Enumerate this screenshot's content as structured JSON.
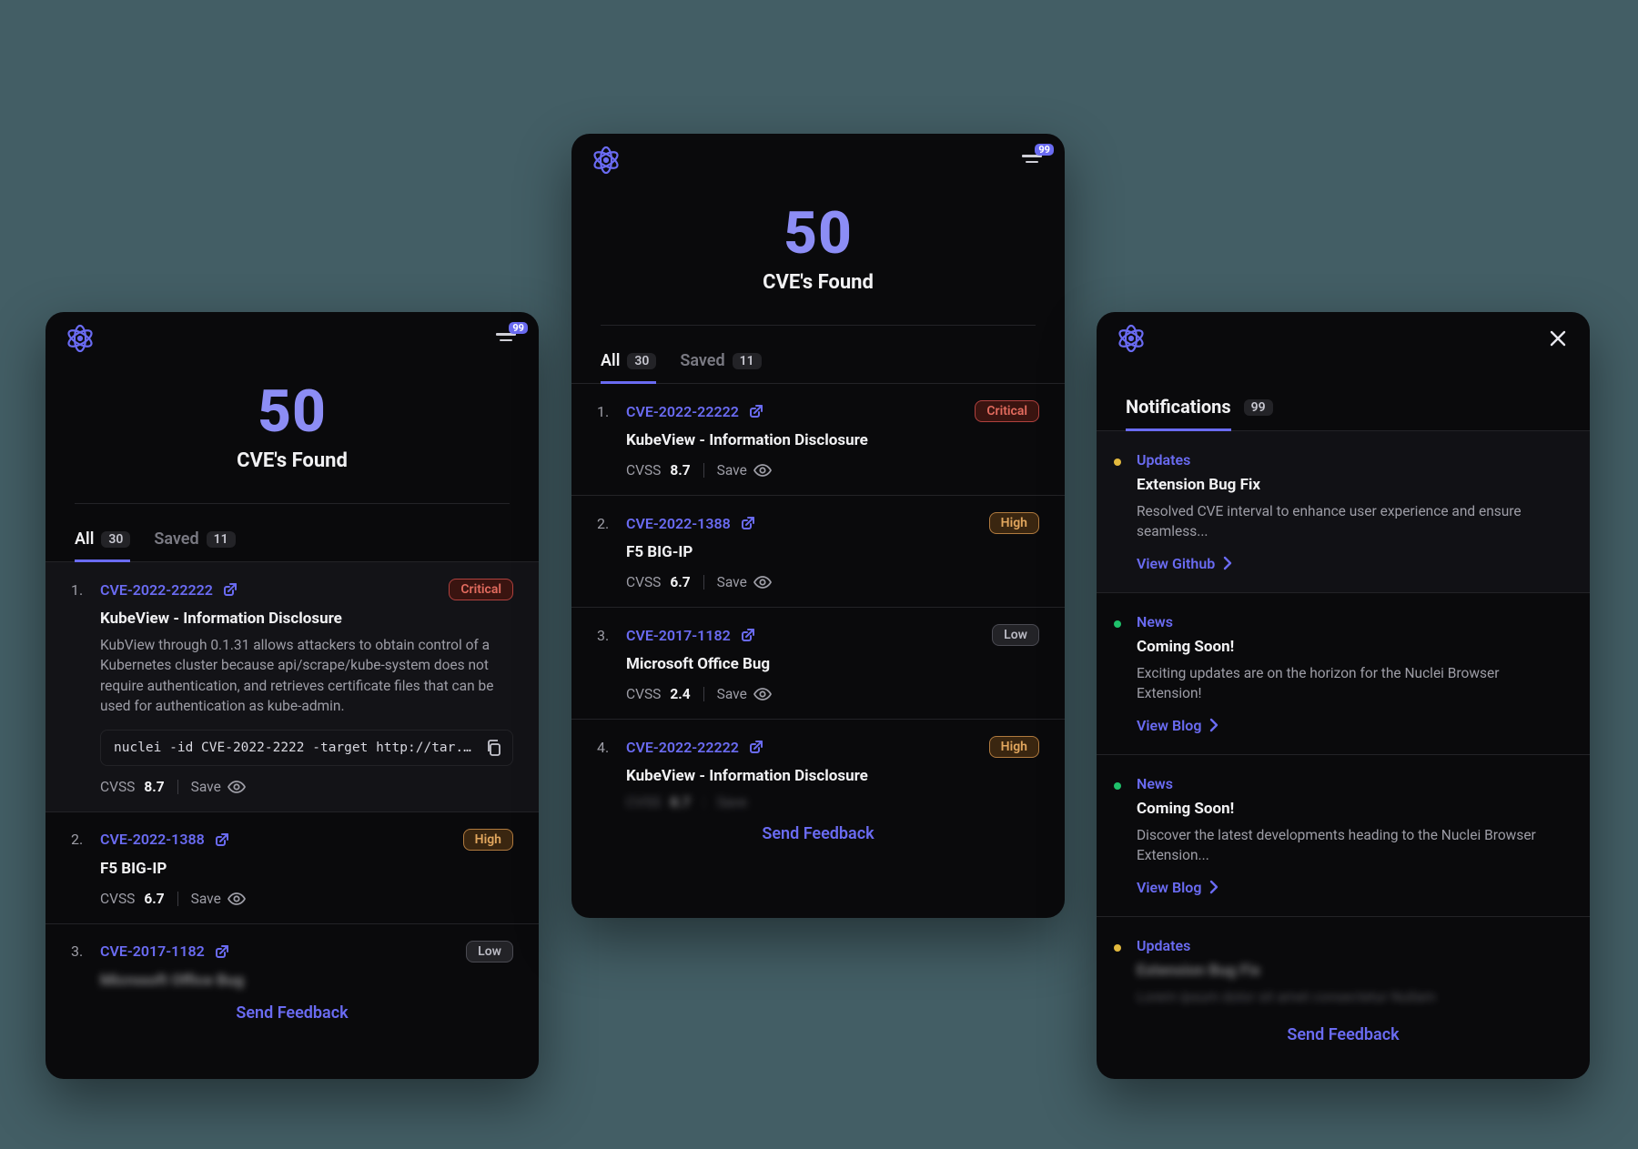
{
  "filter_badge": "99",
  "hero": {
    "count": "50",
    "label": "CVE's Found"
  },
  "tabs": {
    "all": {
      "label": "All",
      "count": "30"
    },
    "saved": {
      "label": "Saved",
      "count": "11"
    }
  },
  "severity": {
    "critical": "Critical",
    "high": "High",
    "low": "Low"
  },
  "labels": {
    "cvss": "CVSS",
    "save": "Save",
    "feedback": "Send Feedback"
  },
  "panel_a": {
    "items": [
      {
        "idx": "1.",
        "cve": "CVE-2022-22222",
        "sev": "critical",
        "title": "KubeView - Information Disclosure",
        "desc": "KubView through 0.1.31 allows attackers to obtain control of a Kubernetes cluster because api/scrape/kube-system does not require authentication, and retrieves certificate files that can be used for authentication as kube-admin.",
        "cmd": "nuclei -id CVE-2022-2222 -target http://tar...",
        "cvss": "8.7"
      },
      {
        "idx": "2.",
        "cve": "CVE-2022-1388",
        "sev": "high",
        "title": "F5 BIG-IP",
        "cvss": "6.7"
      },
      {
        "idx": "3.",
        "cve": "CVE-2017-1182",
        "sev": "low",
        "title_blur": "Microsoft Office Bug"
      }
    ]
  },
  "panel_b": {
    "items": [
      {
        "idx": "1.",
        "cve": "CVE-2022-22222",
        "sev": "critical",
        "title": "KubeView - Information Disclosure",
        "cvss": "8.7"
      },
      {
        "idx": "2.",
        "cve": "CVE-2022-1388",
        "sev": "high",
        "title": "F5 BIG-IP",
        "cvss": "6.7"
      },
      {
        "idx": "3.",
        "cve": "CVE-2017-1182",
        "sev": "low",
        "title": "Microsoft Office Bug",
        "cvss": "2.4"
      },
      {
        "idx": "4.",
        "cve": "CVE-2022-22222",
        "sev": "high",
        "title": "KubeView - Information Disclosure",
        "cvss_blur": "8.7"
      }
    ]
  },
  "notifications": {
    "heading": "Notifications",
    "count": "99",
    "items": [
      {
        "dot": "yellow",
        "category": "Updates",
        "title": "Extension Bug Fix",
        "desc": "Resolved CVE interval to enhance user experience and ensure seamless...",
        "link": "View Github"
      },
      {
        "dot": "green",
        "category": "News",
        "title": "Coming Soon!",
        "desc": "Exciting updates are on the horizon for the Nuclei Browser Extension!",
        "link": "View Blog"
      },
      {
        "dot": "green",
        "category": "News",
        "title": "Coming Soon!",
        "desc": "Discover the latest developments heading to the Nuclei Browser Extension...",
        "link": "View Blog"
      },
      {
        "dot": "yellow",
        "category": "Updates",
        "title_blur": "Extension Bug Fix",
        "desc_blur": "Lorem ipsum dolor sit amet consectetur Nullam"
      }
    ]
  }
}
